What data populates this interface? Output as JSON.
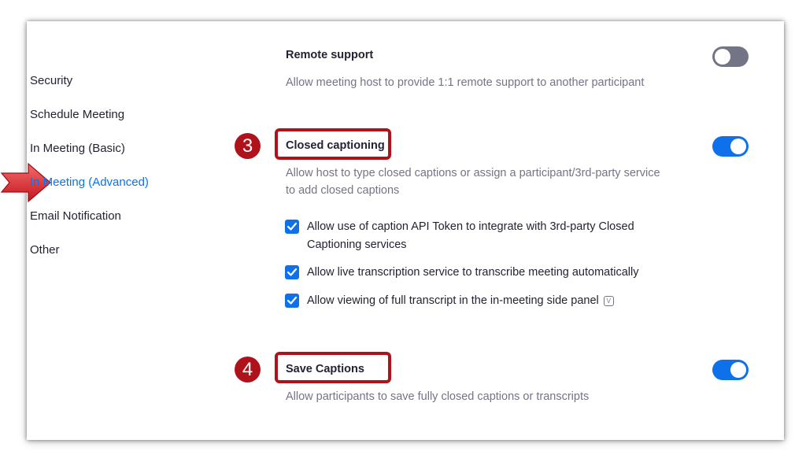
{
  "sidebar": {
    "items": [
      {
        "label": "Security"
      },
      {
        "label": "Schedule Meeting"
      },
      {
        "label": "In Meeting (Basic)"
      },
      {
        "label": "In Meeting (Advanced)",
        "active": true
      },
      {
        "label": "Email Notification"
      },
      {
        "label": "Other"
      }
    ]
  },
  "settings": {
    "remote_support": {
      "title": "Remote support",
      "description": "Allow meeting host to provide 1:1 remote support to another participant",
      "enabled": false
    },
    "closed_captioning": {
      "step": "3",
      "title": "Closed captioning",
      "description_line1": "Allow host to type closed captions or assign a participant/3rd-party service",
      "description_line2": "to add closed captions",
      "enabled": true,
      "options": [
        {
          "line1": "Allow use of caption API Token to integrate with 3rd-party Closed",
          "line2": "Captioning services",
          "checked": true
        },
        {
          "line1": "Allow live transcription service to transcribe meeting automatically",
          "checked": true
        },
        {
          "line1": "Allow viewing of full transcript in the in-meeting side panel",
          "checked": true,
          "info_icon": "V"
        }
      ]
    },
    "save_captions": {
      "step": "4",
      "title": "Save Captions",
      "description": "Allow participants to save fully closed captions or transcripts",
      "enabled": true
    }
  },
  "colors": {
    "accent_blue": "#0e71eb",
    "highlight_red": "#b0121c",
    "text_dark": "#232333",
    "text_muted": "#747487"
  },
  "icons": {
    "pointer_arrow": "red-right-arrow-icon",
    "checkmark": "checkmark-icon",
    "info": "info-icon"
  }
}
